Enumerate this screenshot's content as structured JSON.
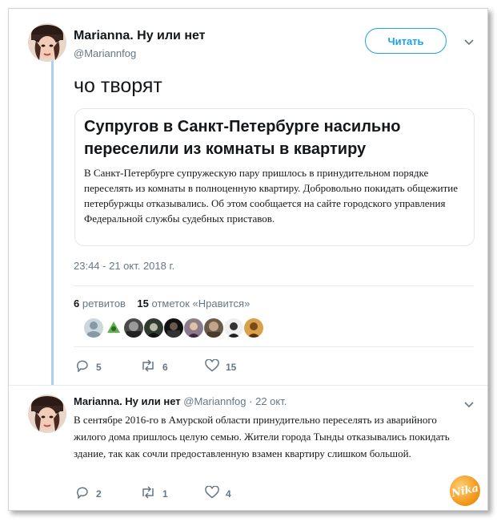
{
  "tweet": {
    "author_name": "Marianna. Ну или нет",
    "author_handle": "@Mariannfog",
    "follow_label": "Читать",
    "text": "чо творят",
    "link_card": {
      "title": "Супругов в Санкт-Петербурге насильно переселили из комнаты в квартиру",
      "description": "В Санкт-Петербурге супружескую пару пришлось в принудительном порядке переселять из комнаты в полноценную квартиру. Добровольно покидать общежитие петербуржцы отказывались. Об этом сообщается на сайте городского управления Федеральной службы судебных приставов."
    },
    "timestamp": "23:44 - 21 окт. 2018 г.",
    "retweets_count": "6",
    "retweets_label": "ретвитов",
    "likes_count": "15",
    "likes_label": "отметок «Нравится»",
    "liker_avatars": 9,
    "actions": {
      "replies": "5",
      "retweets": "6",
      "likes": "15"
    }
  },
  "reply": {
    "author_name": "Marianna. Ну или нет",
    "author_handle": "@Mariannfog",
    "date": "· 22 окт.",
    "text": "В сентябре 2016-го в Амурской области принудительно переселять из аварийного жилого дома пришлось целую семью. Жители города Тынды отказывались покидать здание, так как сочли предоставленную взамен квартиру слишком большой.",
    "actions": {
      "replies": "2",
      "retweets": "1",
      "likes": "4"
    }
  },
  "watermark": "Nika",
  "colors": {
    "accent": "#1da1f2",
    "muted": "#657786",
    "thread_line": "#a9d1f5"
  }
}
